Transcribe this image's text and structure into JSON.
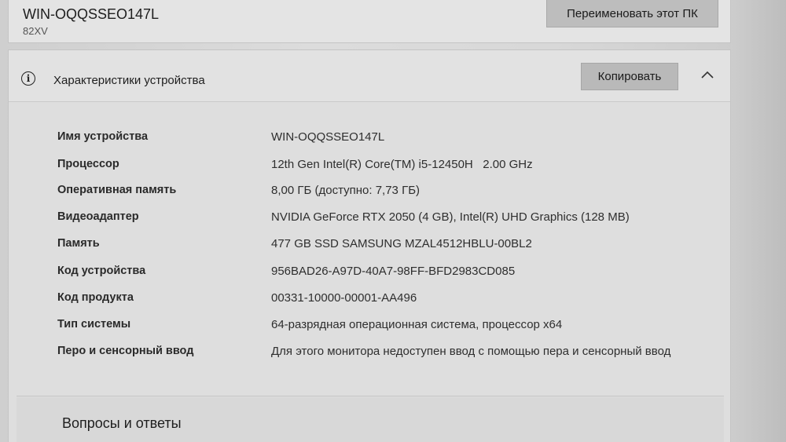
{
  "device_card": {
    "name": "WIN-OQQSSEO147L",
    "model": "82XV",
    "rename_label": "Переименовать этот ПК"
  },
  "specs": {
    "title": "Характеристики устройства",
    "copy_label": "Копировать",
    "icons": {
      "info": "info-icon",
      "collapse": "chevron-up-icon"
    },
    "rows": [
      {
        "label": "Имя устройства",
        "value": "WIN-OQQSSEO147L"
      },
      {
        "label": "Процессор",
        "value": "12th Gen Intel(R) Core(TM) i5-12450H   2.00 GHz"
      },
      {
        "label": "Оперативная память",
        "value": "8,00 ГБ (доступно: 7,73 ГБ)"
      },
      {
        "label": "Видеоадаптер",
        "value": "NVIDIA GeForce RTX 2050 (4 GB), Intel(R) UHD Graphics (128 MB)"
      },
      {
        "label": "Память",
        "value": "477 GB SSD SAMSUNG MZAL4512HBLU-00BL2"
      },
      {
        "label": "Код устройства",
        "value": "956BAD26-A97D-40A7-98FF-BFD2983CD085"
      },
      {
        "label": "Код продукта",
        "value": "00331-10000-00001-AA496"
      },
      {
        "label": "Тип системы",
        "value": "64-разрядная операционная система, процессор x64"
      },
      {
        "label": "Перо и сенсорный ввод",
        "value": "Для этого монитора недоступен ввод с помощью пера и сенсорный ввод"
      }
    ]
  },
  "faq": {
    "title": "Вопросы и ответы"
  }
}
